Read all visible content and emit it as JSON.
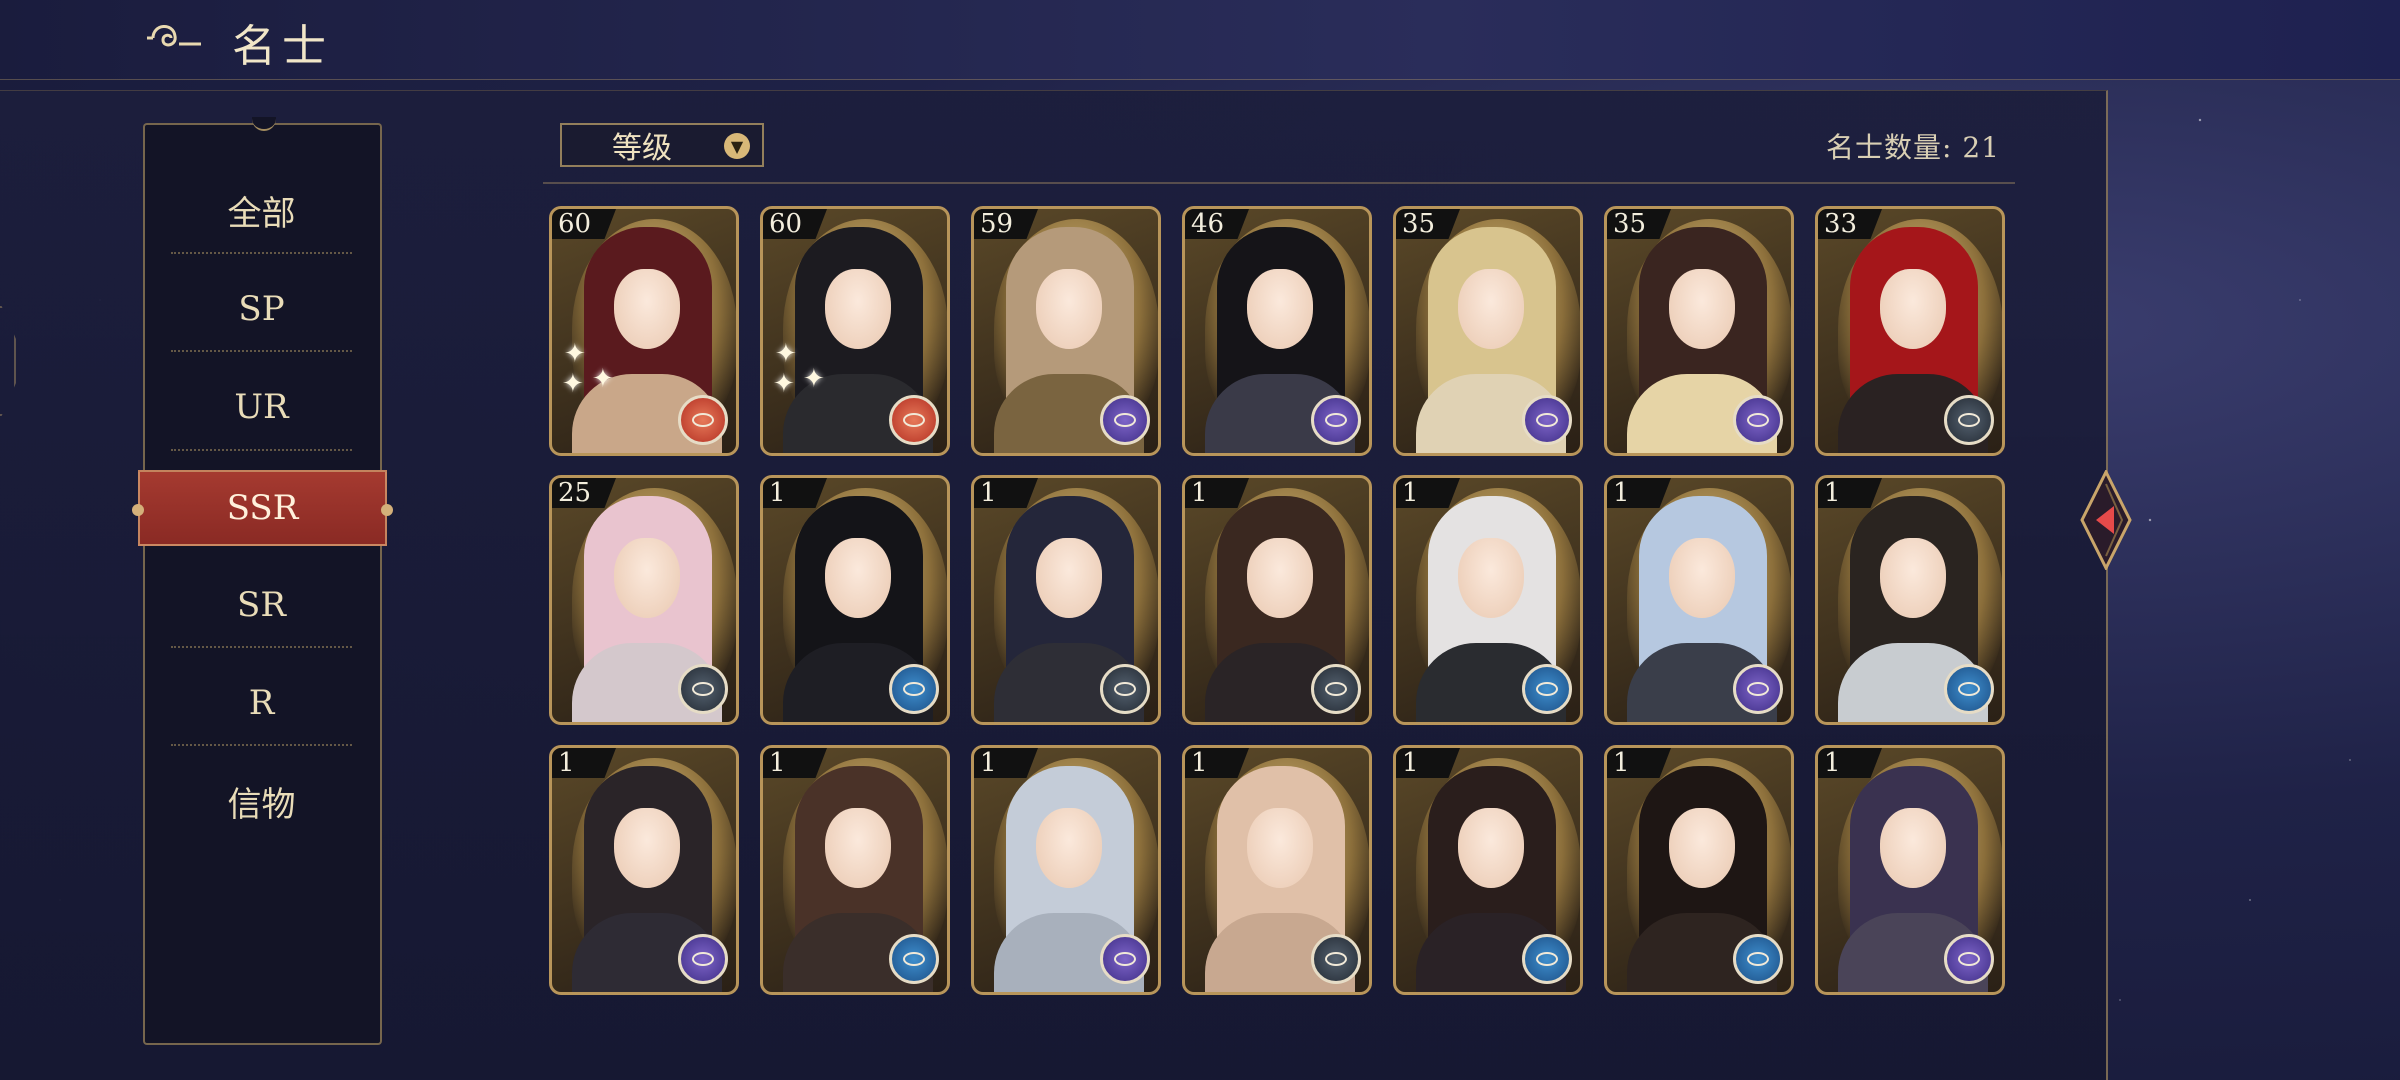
{
  "header": {
    "title": "名士"
  },
  "sidebar": {
    "items": [
      {
        "label": "全部"
      },
      {
        "label": "SP"
      },
      {
        "label": "UR"
      },
      {
        "label": "SSR"
      },
      {
        "label": "SR"
      },
      {
        "label": "R"
      },
      {
        "label": "信物"
      }
    ],
    "active": "SSR"
  },
  "sort": {
    "label": "等级"
  },
  "count": {
    "label": "名士数量: 21"
  },
  "cards": [
    {
      "level": "60",
      "badge": "red",
      "hair": "#5a1a1e",
      "body": "#c9a789"
    },
    {
      "level": "60",
      "badge": "red",
      "hair": "#1c1b20",
      "body": "#2a2a2e"
    },
    {
      "level": "59",
      "badge": "purple",
      "hair": "#b59a7a",
      "body": "#7a6440"
    },
    {
      "level": "46",
      "badge": "purple",
      "hair": "#151418",
      "body": "#3a3a48"
    },
    {
      "level": "35",
      "badge": "purple",
      "hair": "#d8c48e",
      "body": "#e0d2b4"
    },
    {
      "level": "35",
      "badge": "purple",
      "hair": "#3a2520",
      "body": "#e6d4a6"
    },
    {
      "level": "33",
      "badge": "dark",
      "hair": "#a5161a",
      "body": "#2a2222"
    },
    {
      "level": "25",
      "badge": "dark",
      "hair": "#e9c4cf",
      "body": "#d4c8cc"
    },
    {
      "level": "1",
      "badge": "blue",
      "hair": "#141418",
      "body": "#1e1e24"
    },
    {
      "level": "1",
      "badge": "dark",
      "hair": "#24263a",
      "body": "#2e2e36"
    },
    {
      "level": "1",
      "badge": "dark",
      "hair": "#3a2820",
      "body": "#2a2426"
    },
    {
      "level": "1",
      "badge": "blue",
      "hair": "#e4e2e2",
      "body": "#2a2c30"
    },
    {
      "level": "1",
      "badge": "purple",
      "hair": "#b6c8e0",
      "body": "#3a3e4a"
    },
    {
      "level": "1",
      "badge": "blue",
      "hair": "#2a2420",
      "body": "#c8ccd0"
    },
    {
      "level": "1",
      "badge": "purple",
      "hair": "#2a2428",
      "body": "#2e2b34"
    },
    {
      "level": "1",
      "badge": "blue",
      "hair": "#4a3228",
      "body": "#3a2e2a"
    },
    {
      "level": "1",
      "badge": "purple",
      "hair": "#c4ccd8",
      "body": "#a8b0bc"
    },
    {
      "level": "1",
      "badge": "dark",
      "hair": "#e0c0a8",
      "body": "#c8a890"
    },
    {
      "level": "1",
      "badge": "blue",
      "hair": "#2a1e1c",
      "body": "#2a2226"
    },
    {
      "level": "1",
      "badge": "blue",
      "hair": "#1e1614",
      "body": "#2e2420"
    },
    {
      "level": "1",
      "badge": "purple",
      "hair": "#3a3250",
      "body": "#4a4458"
    }
  ]
}
